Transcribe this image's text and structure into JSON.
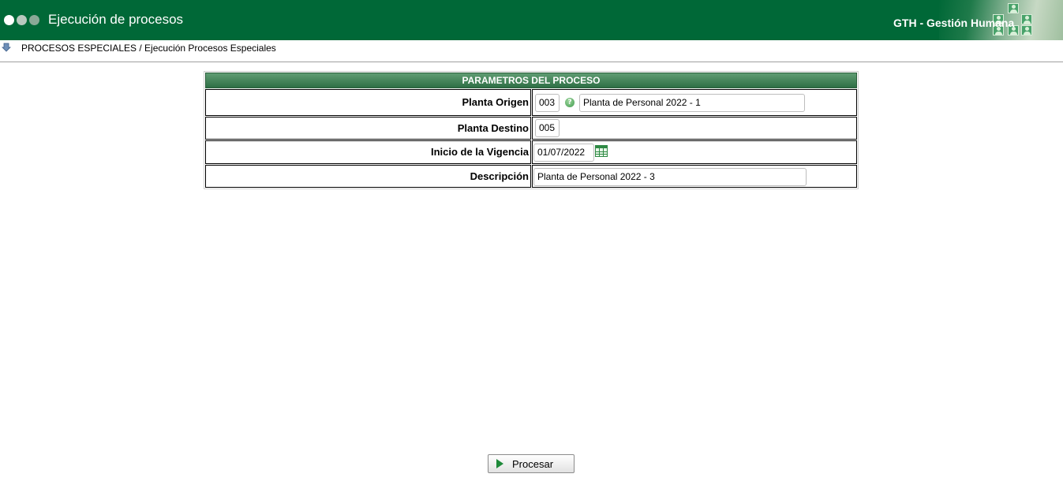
{
  "header": {
    "title": "Ejecución de procesos",
    "brand": "GTH - Gestión Humana"
  },
  "breadcrumb": "PROCESOS ESPECIALES / Ejecución Procesos Especiales",
  "panel": {
    "title": "PARAMETROS DEL PROCESO",
    "rows": [
      {
        "label": "Planta Origen",
        "code": "003",
        "description": "Planta de Personal 2022 - 1"
      },
      {
        "label": "Planta Destino",
        "code": "005"
      },
      {
        "label": "Inicio de la Vigencia",
        "value": "01/07/2022"
      },
      {
        "label": "Descripción",
        "value": "Planta de Personal 2022 - 3"
      }
    ]
  },
  "actions": {
    "process_label": "Procesar"
  },
  "icons": {
    "breadcrumb": "down-arrow-icon",
    "help": "help-icon",
    "calendar": "calendar-icon",
    "process": "play-icon"
  },
  "colors": {
    "header": "#006837",
    "panel_title": "#2e6f45"
  }
}
